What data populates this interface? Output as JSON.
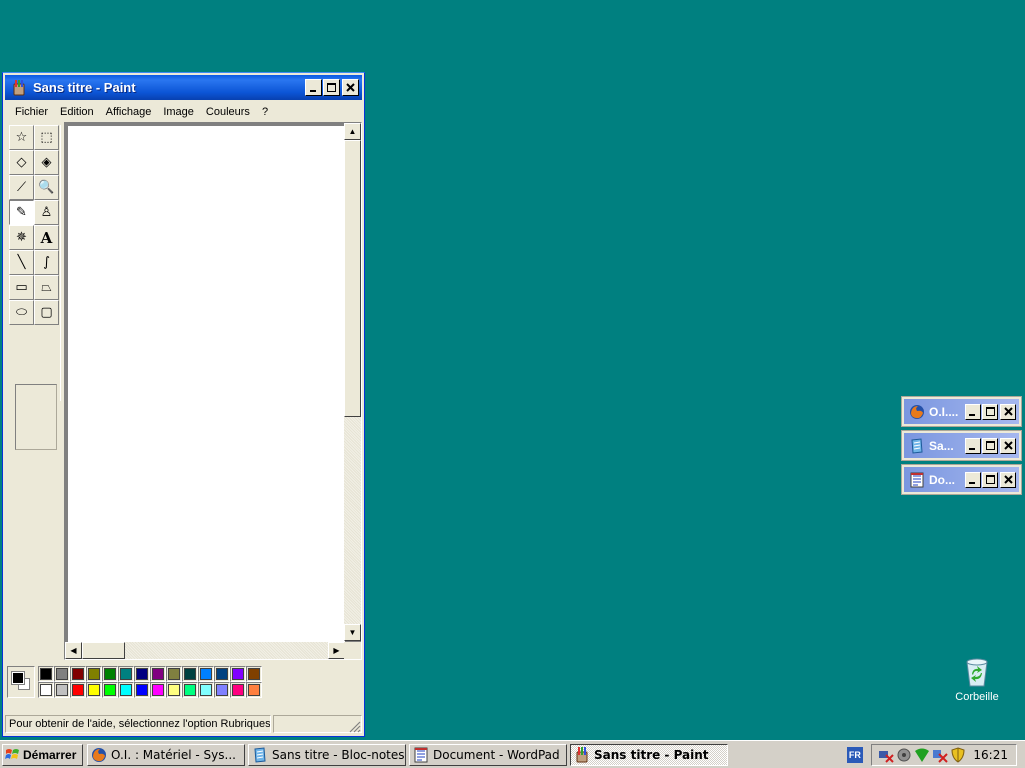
{
  "paint_window": {
    "title": "Sans titre - Paint",
    "menu": [
      "Fichier",
      "Edition",
      "Affichage",
      "Image",
      "Couleurs",
      "?"
    ],
    "status_text": "Pour obtenir de l'aide, sélectionnez l'option Rubriques d'aide du menu ?",
    "tools": [
      {
        "name": "free-select-icon",
        "glyph": "☆"
      },
      {
        "name": "rect-select-icon",
        "glyph": "⬚"
      },
      {
        "name": "eraser-icon",
        "glyph": "◇"
      },
      {
        "name": "fill-bucket-icon",
        "glyph": "◈"
      },
      {
        "name": "color-picker-icon",
        "glyph": "⟋"
      },
      {
        "name": "magnifier-icon",
        "glyph": "🔍"
      },
      {
        "name": "pencil-icon",
        "glyph": "✎"
      },
      {
        "name": "brush-icon",
        "glyph": "♙"
      },
      {
        "name": "airbrush-icon",
        "glyph": "✵"
      },
      {
        "name": "text-icon",
        "glyph": "A"
      },
      {
        "name": "line-icon",
        "glyph": "╲"
      },
      {
        "name": "curve-icon",
        "glyph": "∫"
      },
      {
        "name": "rectangle-icon",
        "glyph": "▭"
      },
      {
        "name": "polygon-icon",
        "glyph": "⏢"
      },
      {
        "name": "ellipse-icon",
        "glyph": "⬭"
      },
      {
        "name": "rounded-rect-icon",
        "glyph": "▢"
      }
    ],
    "active_tool_index": 6,
    "palette_top": [
      "#000000",
      "#808080",
      "#800000",
      "#808000",
      "#008000",
      "#008080",
      "#000080",
      "#800080",
      "#808040",
      "#004040",
      "#0080ff",
      "#004080",
      "#8000ff",
      "#804000"
    ],
    "palette_bottom": [
      "#ffffff",
      "#c0c0c0",
      "#ff0000",
      "#ffff00",
      "#00ff00",
      "#00ffff",
      "#0000ff",
      "#ff00ff",
      "#ffff80",
      "#00ff80",
      "#80ffff",
      "#8080ff",
      "#ff0080",
      "#ff8040"
    ],
    "foreground_color": "#000000",
    "background_color": "#ffffff"
  },
  "minimized_windows": [
    {
      "title": "O.I....",
      "icon": "firefox-icon"
    },
    {
      "title": "Sa...",
      "icon": "notepad-icon"
    },
    {
      "title": "Do...",
      "icon": "wordpad-icon"
    }
  ],
  "desktop": {
    "recycle_bin_label": "Corbeille"
  },
  "taskbar": {
    "start_label": "Démarrer",
    "tasks": [
      {
        "label": "O.I. : Matériel - Sys...",
        "icon": "firefox-icon",
        "active": false
      },
      {
        "label": "Sans titre - Bloc-notes",
        "icon": "notepad-icon",
        "active": false
      },
      {
        "label": "Document - WordPad",
        "icon": "wordpad-icon",
        "active": false
      },
      {
        "label": "Sans titre - Paint",
        "icon": "paint-icon",
        "active": true
      }
    ],
    "language": "FR",
    "clock": "16:21"
  }
}
